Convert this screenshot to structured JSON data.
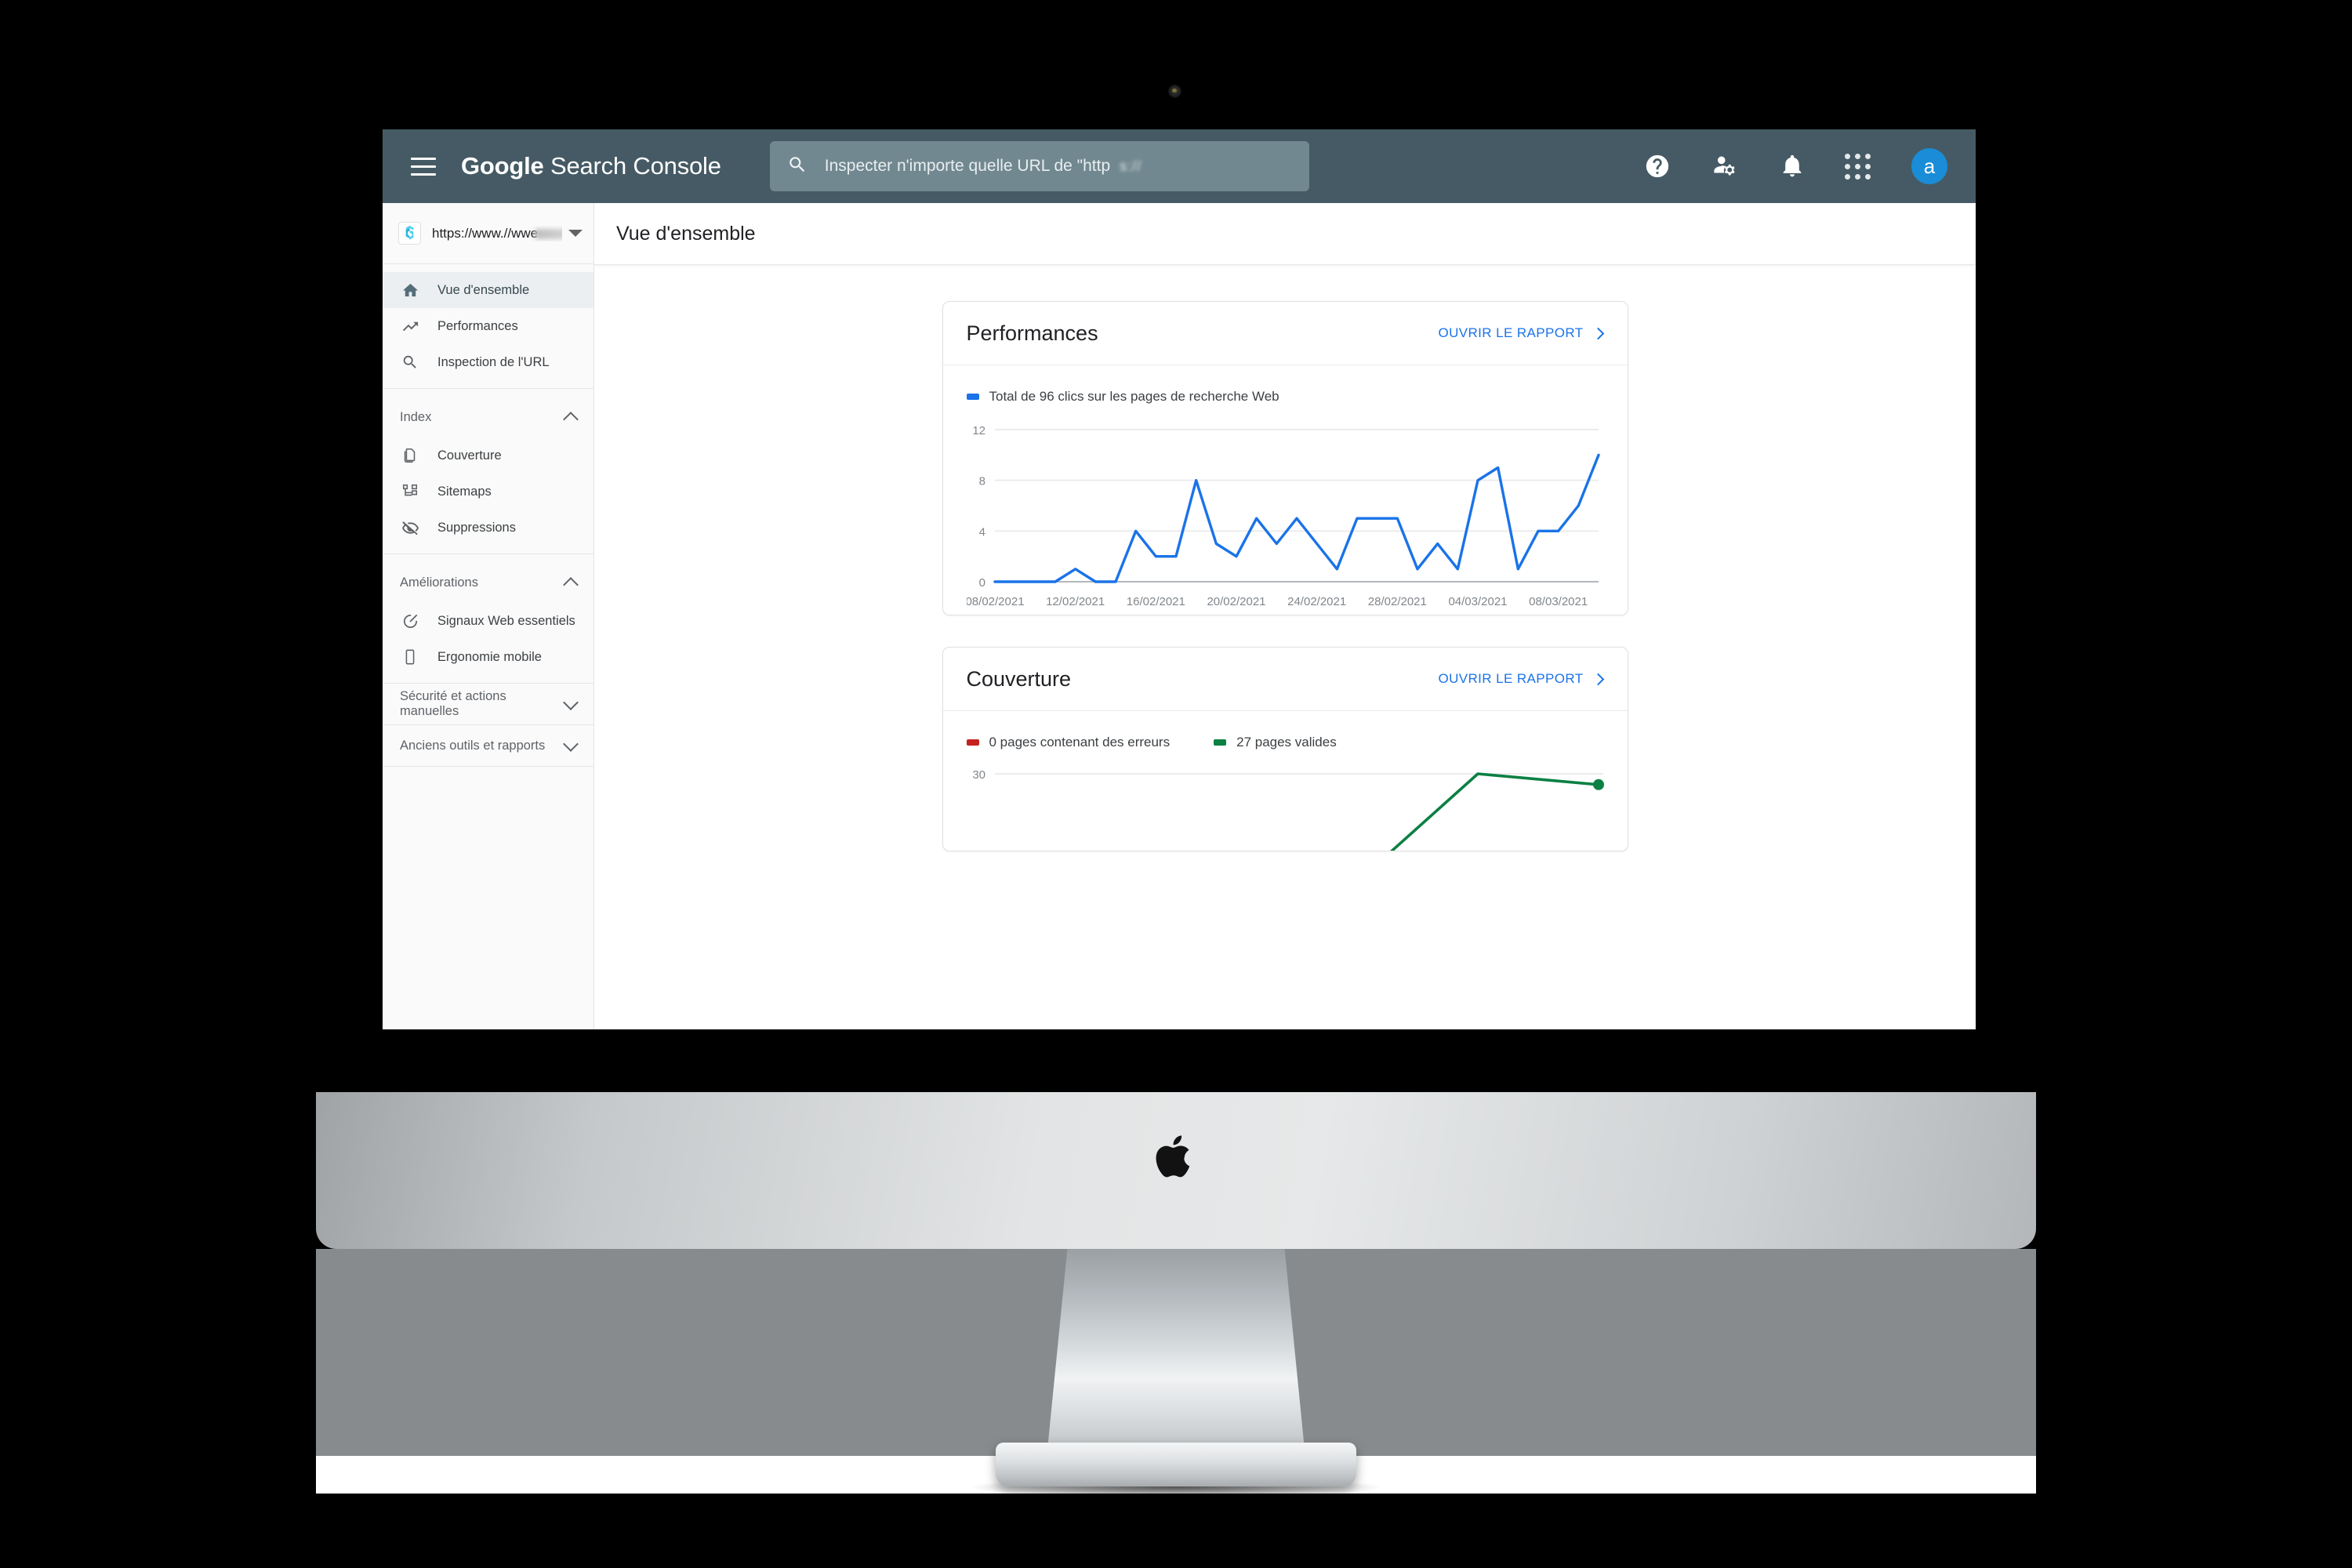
{
  "topbar": {
    "menu_icon": "hamburger-menu-icon",
    "brand_bold": "Google",
    "brand_regular": " Search Console",
    "search": {
      "icon": "search-icon",
      "placeholder": "Inspecter n'importe quelle URL de \"http",
      "blurred_suffix": "s://"
    },
    "icons": [
      {
        "name": "help-icon",
        "glyph": "?"
      },
      {
        "name": "account-settings-icon",
        "glyph": "person-gear"
      },
      {
        "name": "notifications-bell-icon",
        "glyph": "bell"
      },
      {
        "name": "apps-grid-icon",
        "glyph": "grid-9"
      }
    ],
    "avatar_letter": "a",
    "avatar_color": "#1a8cd8",
    "background_color": "#455a64"
  },
  "sidebar": {
    "property": {
      "icon": "property-logo-icon",
      "url": "https://www.//wwe",
      "dropdown_icon": "caret-down-icon"
    },
    "primary_items": [
      {
        "label": "Vue d'ensemble",
        "icon": "home-icon",
        "active": true
      },
      {
        "label": "Performances",
        "icon": "trending-up-icon",
        "active": false
      },
      {
        "label": "Inspection de l'URL",
        "icon": "search-icon",
        "active": false
      }
    ],
    "sections": [
      {
        "heading": "Index",
        "expanded": true,
        "items": [
          {
            "label": "Couverture",
            "icon": "pages-copy-icon"
          },
          {
            "label": "Sitemaps",
            "icon": "sitemap-icon"
          },
          {
            "label": "Suppressions",
            "icon": "eye-off-icon"
          }
        ]
      },
      {
        "heading": "Améliorations",
        "expanded": true,
        "items": [
          {
            "label": "Signaux Web essentiels",
            "icon": "speedometer-icon"
          },
          {
            "label": "Ergonomie mobile",
            "icon": "mobile-phone-icon"
          }
        ]
      }
    ],
    "collapsed_sections": [
      {
        "heading": "Sécurité et actions manuelles",
        "expanded": false
      },
      {
        "heading": "Anciens outils et rapports",
        "expanded": false
      }
    ]
  },
  "page": {
    "title": "Vue d'ensemble"
  },
  "cards": [
    {
      "title": "Performances",
      "open_report_label": "OUVRIR LE RAPPORT",
      "open_report_icon": "chevron-right-icon"
    },
    {
      "title": "Couverture",
      "open_report_label": "OUVRIR LE RAPPORT",
      "open_report_icon": "chevron-right-icon"
    }
  ],
  "chart_data": [
    {
      "type": "line",
      "title": "Performances",
      "legend": [
        {
          "label": "Total de 96 clics sur les pages de recherche Web",
          "color": "#1a73e8"
        }
      ],
      "legend_position": "top-left",
      "xlabel": "",
      "ylabel": "",
      "ylim": [
        0,
        12
      ],
      "yticks": [
        0,
        4,
        8,
        12
      ],
      "grid": true,
      "xticks": [
        "08/02/2021",
        "12/02/2021",
        "16/02/2021",
        "20/02/2021",
        "24/02/2021",
        "28/02/2021",
        "04/03/2021",
        "08/03/2021"
      ],
      "x": [
        "08/02/2021",
        "09/02/2021",
        "10/02/2021",
        "11/02/2021",
        "12/02/2021",
        "13/02/2021",
        "14/02/2021",
        "15/02/2021",
        "16/02/2021",
        "17/02/2021",
        "18/02/2021",
        "19/02/2021",
        "20/02/2021",
        "21/02/2021",
        "22/02/2021",
        "23/02/2021",
        "24/02/2021",
        "25/02/2021",
        "26/02/2021",
        "27/02/2021",
        "28/02/2021",
        "01/03/2021",
        "02/03/2021",
        "03/03/2021",
        "04/03/2021",
        "05/03/2021",
        "06/03/2021",
        "07/03/2021",
        "08/03/2021",
        "09/03/2021"
      ],
      "series": [
        {
          "name": "Total de 96 clics sur les pages de recherche Web",
          "color": "#1a73e8",
          "values": [
            0,
            0,
            0,
            0,
            1,
            0,
            0,
            4,
            2,
            2,
            8,
            3,
            2,
            5,
            3,
            5,
            3,
            1,
            5,
            5,
            5,
            1,
            3,
            1,
            8,
            9,
            1,
            4,
            4,
            6,
            10
          ]
        }
      ]
    },
    {
      "type": "line",
      "title": "Couverture",
      "legend": [
        {
          "label": "0 pages contenant des erreurs",
          "color": "#c5221f"
        },
        {
          "label": "27 pages valides",
          "color": "#0b8043"
        }
      ],
      "legend_position": "top-left",
      "ylim": [
        0,
        30
      ],
      "yticks": [
        30
      ],
      "grid": true,
      "series": [
        {
          "name": "0 pages contenant des erreurs",
          "color": "#c5221f",
          "values": [
            0,
            0,
            0,
            0,
            0,
            0
          ]
        },
        {
          "name": "27 pages valides",
          "color": "#0b8043",
          "values": [
            0,
            0,
            0,
            0,
            30,
            27
          ]
        }
      ]
    }
  ],
  "device": {
    "brand_icon": "apple-logo-icon",
    "camera_icon": "webcam-dot-icon"
  }
}
